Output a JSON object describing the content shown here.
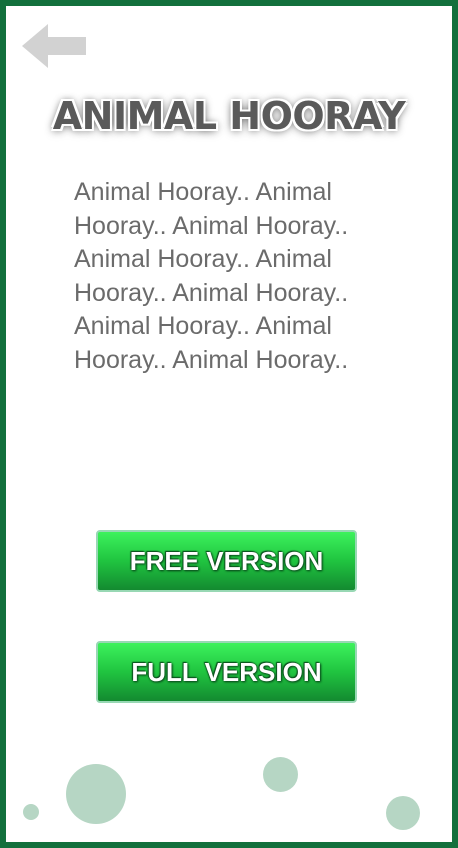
{
  "title": "ANIMAL HOORAY",
  "description": "Animal Hooray.. Animal Hooray.. Animal Hooray.. Animal Hooray.. Animal Hooray.. Animal Hooray.. Animal Hooray.. Animal Hooray.. Animal Hooray..",
  "buttons": {
    "free_label": "FREE VERSION",
    "full_label": "FULL VERSION"
  },
  "icons": {
    "back": "back-arrow-icon"
  },
  "colors": {
    "border": "#12703c",
    "button_green": "#20c440",
    "text_gray": "#6b6b6b",
    "bubble": "#b6d6c4"
  }
}
